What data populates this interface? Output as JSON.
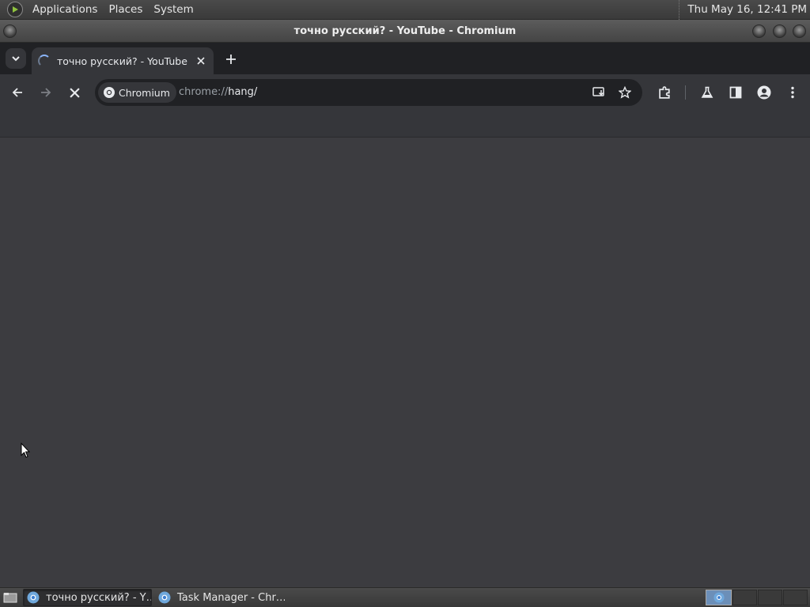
{
  "top_panel": {
    "menus": [
      "Applications",
      "Places",
      "System"
    ],
    "clock": "Thu May 16, 12:41 PM"
  },
  "window": {
    "title": "точно русский? - YouTube - Chromium"
  },
  "browser": {
    "tab": {
      "title": "точно русский? - YouTube"
    },
    "omnibox": {
      "chip_label": "Chromium",
      "url_scheme": "chrome://",
      "url_host": "hang/"
    }
  },
  "taskbar": {
    "tasks": [
      {
        "label": "точно русский? - Y…",
        "active": true
      },
      {
        "label": "Task Manager - Chr…",
        "active": false
      }
    ]
  },
  "colors": {
    "accent": "#8ab4f8",
    "toolbar": "#35363a",
    "tabstrip": "#202124",
    "content": "#3c3c40"
  },
  "icons": [
    "menu-logo-icon",
    "tab-search-icon",
    "loading-spinner-icon",
    "close-icon",
    "plus-icon",
    "back-arrow-icon",
    "forward-arrow-icon",
    "stop-icon",
    "chromium-icon",
    "install-app-icon",
    "star-icon",
    "extensions-icon",
    "flask-icon",
    "side-panel-icon",
    "profile-icon",
    "more-vert-icon",
    "show-desktop-icon",
    "mouse-cursor-icon"
  ]
}
